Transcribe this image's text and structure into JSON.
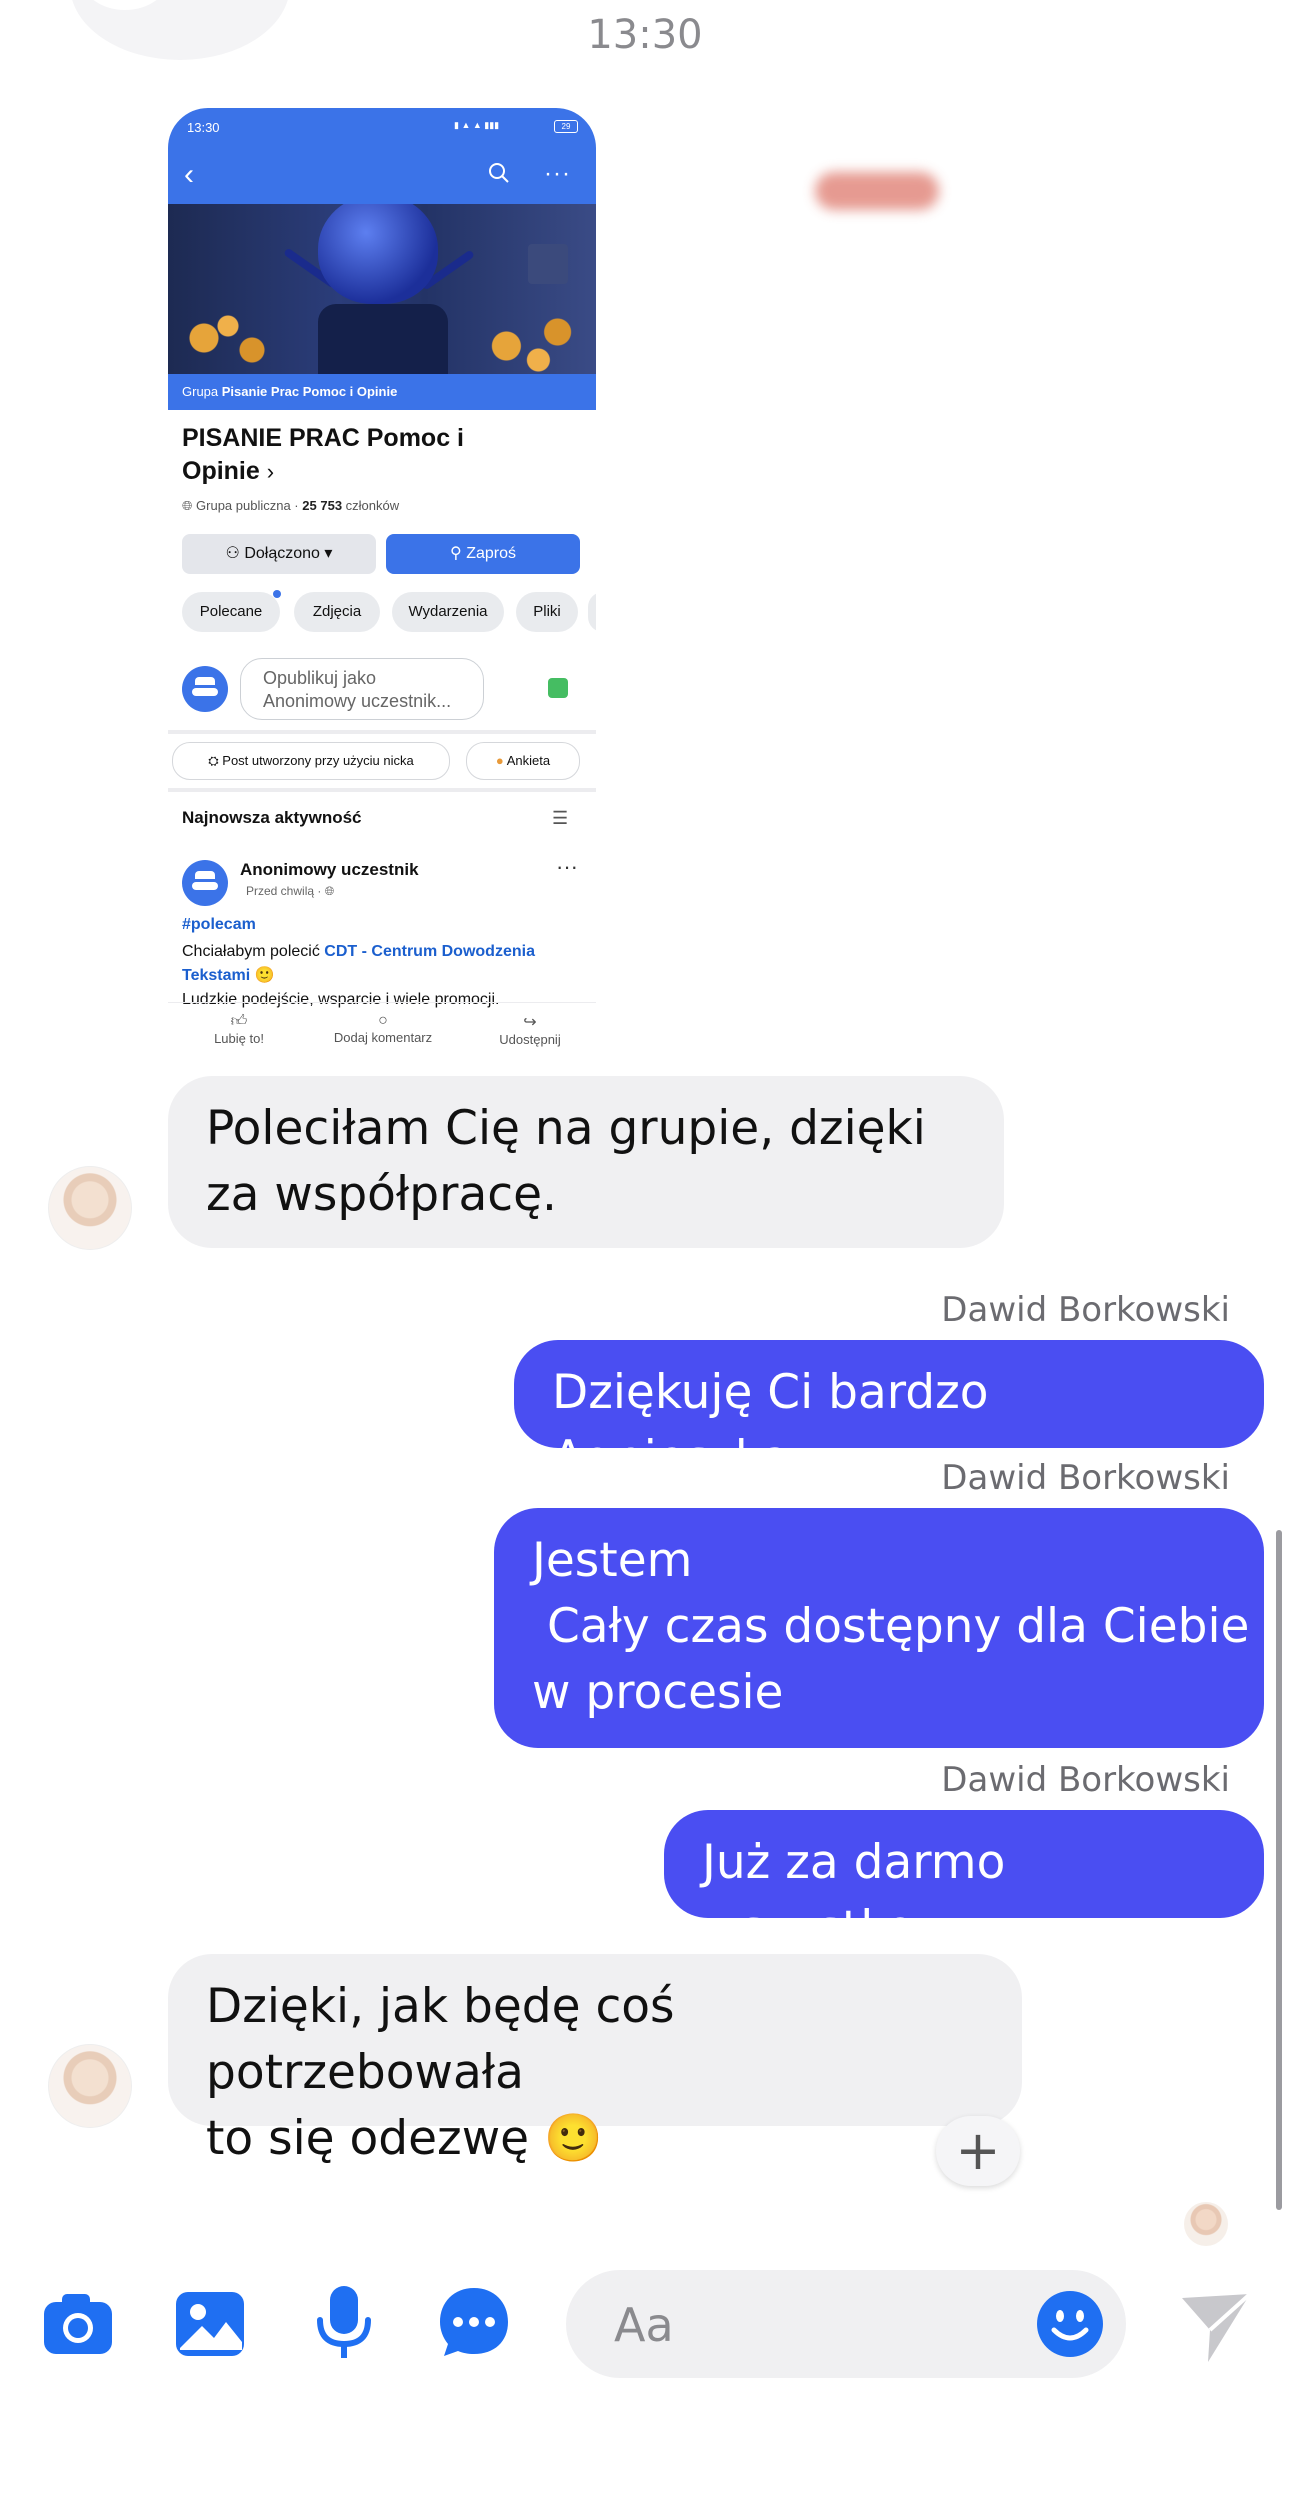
{
  "status": {
    "time": "13:30"
  },
  "shared_screenshot": {
    "status_time": "13:30",
    "battery": "29",
    "group_banner_prefix": "Grupa",
    "group_banner_name": "Pisanie Prac Pomoc i Opinie",
    "group_title": "PISANIE PRAC Pomoc i Opinie",
    "group_title_chevron": "›",
    "group_visibility": "Grupa publiczna ·",
    "group_members_count": "25 753",
    "group_members_word": "członków",
    "joined_button": "Dołączono",
    "invite_button": "Zaproś",
    "tabs": [
      "Polecane",
      "Zdjęcia",
      "Wydarzenia",
      "Pliki"
    ],
    "publish_placeholder": "Opublikuj jako Anonimowy uczestnik...",
    "chip_nick": "Post utworzony przy użyciu nicka",
    "chip_poll": "Ankieta",
    "latest_activity": "Najnowsza aktywność",
    "post_author": "Anonimowy uczestnik",
    "post_time": "Przed chwilą ·",
    "post_hashtag": "#polecam",
    "post_text_1": "Chciałabym polecić",
    "post_link": "CDT - Centrum Dowodzenia Tekstami",
    "post_emoji": "🙂",
    "post_text_2": "Ludzkie podejście, wsparcie i wiele promocji.",
    "actions": [
      "Lubię to!",
      "Dodaj komentarz",
      "Udostępnij"
    ]
  },
  "messages": [
    {
      "direction": "incoming",
      "text": "Poleciłam Cię na grupie, dzięki za współpracę."
    },
    {
      "direction": "outgoing",
      "sender": "Dawid Borkowski",
      "text": "Dziękuję Ci bardzo Agnieszka."
    },
    {
      "direction": "outgoing",
      "sender": "Dawid Borkowski",
      "lines": [
        "Jestem",
        " Cały czas dostępny dla Ciebie",
        "w procesie"
      ]
    },
    {
      "direction": "outgoing",
      "sender": "Dawid Borkowski",
      "text": "Już za darmo wszystko"
    },
    {
      "direction": "incoming",
      "lines": [
        "Dzięki, jak będę coś potrzebowała",
        "to się odezwę 🙂"
      ]
    }
  ],
  "reaction_button": "+",
  "composer": {
    "placeholder": "Aa",
    "icons": [
      "camera-icon",
      "gallery-icon",
      "microphone-icon",
      "chat-more-icon",
      "emoji-icon",
      "send-icon"
    ]
  },
  "colors": {
    "outgoing_bubble": "#4a4ef2",
    "incoming_bubble": "#f0f0f2",
    "accent": "#1877f2"
  }
}
